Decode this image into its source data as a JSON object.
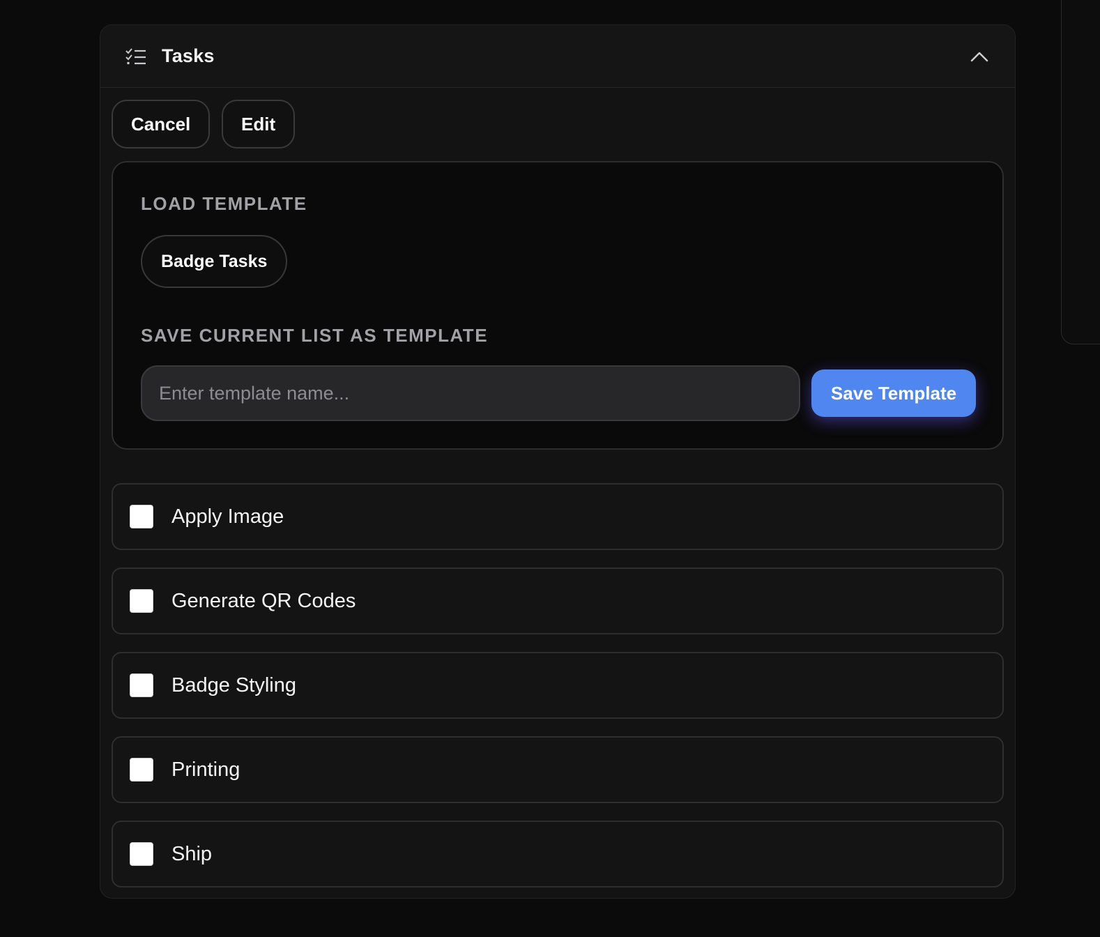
{
  "panel": {
    "title": "Tasks",
    "icon": "checklist-icon",
    "collapse_icon": "chevron-up-icon"
  },
  "toolbar": {
    "cancel_label": "Cancel",
    "edit_label": "Edit"
  },
  "templates": {
    "load_heading": "LOAD TEMPLATE",
    "items": [
      {
        "label": "Badge Tasks"
      }
    ],
    "save_heading": "SAVE CURRENT LIST AS TEMPLATE",
    "name_input": {
      "value": "",
      "placeholder": "Enter template name..."
    },
    "save_label": "Save Template",
    "save_color": "#4f86f0"
  },
  "tasks": [
    {
      "label": "Apply Image",
      "checked": false
    },
    {
      "label": "Generate QR Codes",
      "checked": false
    },
    {
      "label": "Badge Styling",
      "checked": false
    },
    {
      "label": "Printing",
      "checked": false
    },
    {
      "label": "Ship",
      "checked": false
    }
  ]
}
